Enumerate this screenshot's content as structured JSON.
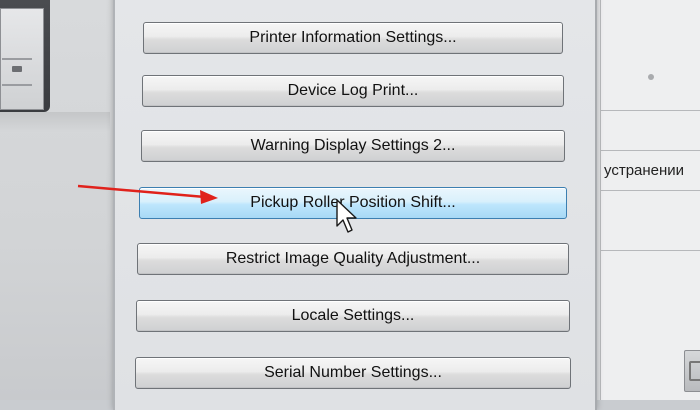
{
  "dialog": {
    "buttons": [
      {
        "label": "Printer Information Settings..."
      },
      {
        "label": "Device Log Print..."
      },
      {
        "label": "Warning Display Settings 2..."
      },
      {
        "label": "Pickup Roller Position Shift..."
      },
      {
        "label": "Restrict Image Quality Adjustment..."
      },
      {
        "label": "Locale Settings..."
      },
      {
        "label": "Serial Number Settings..."
      }
    ],
    "highlighted_index": 3
  },
  "background_right": {
    "text": "устранении"
  },
  "colors": {
    "hover_fill": "#bee6fd",
    "hover_border": "#3c7fb1",
    "annotation_arrow": "#e0221c"
  },
  "icons": [
    "mouse-cursor-icon",
    "red-arrow-annotation"
  ]
}
